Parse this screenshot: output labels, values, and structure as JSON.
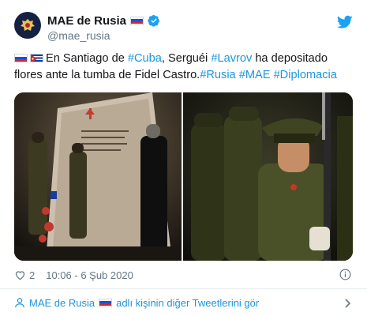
{
  "tweet": {
    "author": {
      "display_name": "MAE de Rusia",
      "handle": "@mae_rusia",
      "verified": true,
      "avatar_icon": "russian-coat-of-arms-icon",
      "name_flag": "russia-flag-icon"
    },
    "text": {
      "flags": [
        "russia-flag-icon",
        "cuba-flag-icon"
      ],
      "segments": [
        {
          "text": "En Santiago de ",
          "link": false
        },
        {
          "text": "#Cuba",
          "link": true
        },
        {
          "text": ", Serguéi ",
          "link": false
        },
        {
          "text": "#Lavrov",
          "link": true
        },
        {
          "text": " ha depositado flores ante la tumba de Fidel Castro.",
          "link": false
        },
        {
          "text": "#Rusia",
          "link": true
        },
        {
          "text": " ",
          "link": false
        },
        {
          "text": "#MAE",
          "link": true
        },
        {
          "text": " ",
          "link": false
        },
        {
          "text": "#Diplomacia",
          "link": true
        }
      ]
    },
    "media": [
      {
        "icon": "photo-memorial-ceremony"
      },
      {
        "icon": "photo-honor-guard-soldier"
      }
    ],
    "likes": "2",
    "timestamp": "10:06 - 6 Şub 2020",
    "icons": {
      "brand": "twitter-bird-icon",
      "like": "heart-icon",
      "info": "info-icon"
    }
  },
  "more_tweets": {
    "name": "MAE de Rusia",
    "suffix": "adlı kişinin diğer Tweetlerini gör",
    "icon": "person-icon",
    "chevron": "chevron-right-icon"
  },
  "colors": {
    "link": "#1b95e0",
    "secondary_text": "#657786",
    "primary_text": "#14171a",
    "divider": "#e6ecf0"
  }
}
